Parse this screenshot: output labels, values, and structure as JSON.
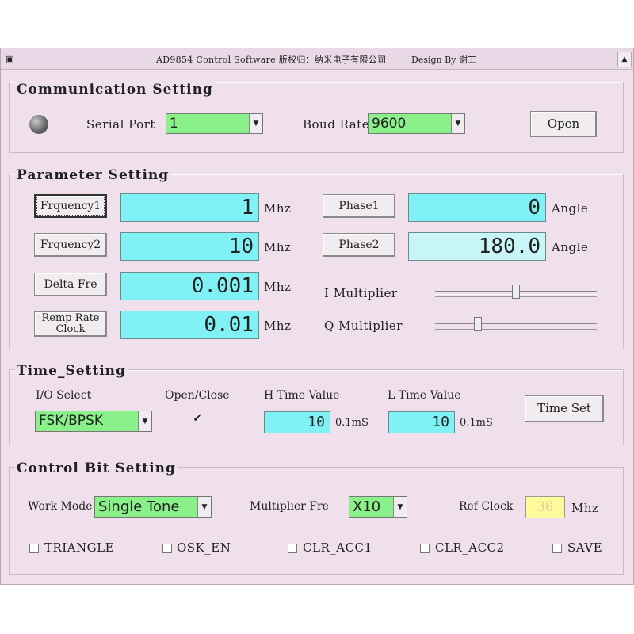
{
  "window": {
    "title": "AD9854 Control Software  版权归：纳米电子有限公司",
    "credit": "Design By 谢工",
    "app_icon": "window-icon",
    "scroll_icon": "chevron-up-icon"
  },
  "communication": {
    "group_title": "Communication Setting",
    "status_led": "led-icon",
    "serial_port_label": "Serial Port",
    "serial_port_value": "1",
    "baud_rate_label": "Boud Rate",
    "baud_rate_value": "9600",
    "open_button": "Open"
  },
  "parameter": {
    "group_title": "Parameter Setting",
    "freq1_button": "Frquency1",
    "freq1_value": "1",
    "freq1_unit": "Mhz",
    "freq2_button": "Frquency2",
    "freq2_value": "10",
    "freq2_unit": "Mhz",
    "delta_button": "Delta Fre",
    "delta_value": "0.001",
    "delta_unit": "Mhz",
    "ramp_button_line1": "Remp Rate",
    "ramp_button_line2": "Clock",
    "ramp_value": "0.01",
    "ramp_unit": "Mhz",
    "phase1_button": "Phase1",
    "phase1_value": "0",
    "phase1_unit": "Angle",
    "phase2_button": "Phase2",
    "phase2_value": "180.0",
    "phase2_unit": "Angle",
    "i_multiplier_label": "I Multiplier",
    "i_multiplier_level": 0.5,
    "q_multiplier_label": "Q Multiplier",
    "q_multiplier_level": 0.25
  },
  "time": {
    "group_title": "Time_Setting",
    "io_select_label": "I/O Select",
    "io_select_value": "FSK/BPSK",
    "open_close_label": "Open/Close",
    "open_close_checked": true,
    "h_time_label": "H Time Value",
    "h_time_value": "10",
    "h_time_unit": "0.1mS",
    "l_time_label": "L Time Value",
    "l_time_value": "10",
    "l_time_unit": "0.1mS",
    "time_set_button": "Time Set"
  },
  "control": {
    "group_title": "Control Bit Setting",
    "work_mode_label": "Work Mode",
    "work_mode_value": "Single Tone",
    "multiplier_label": "Multiplier Fre",
    "multiplier_value": "X10",
    "ref_clock_label": "Ref Clock",
    "ref_clock_value": "30",
    "ref_clock_unit": "Mhz",
    "triangle_label": "TRIANGLE",
    "osk_label": "OSK_EN",
    "clr_acc1_label": "CLR_ACC1",
    "clr_acc2_label": "CLR_ACC2",
    "save_label": "SAVE"
  },
  "colors": {
    "window_bg": "#efe0ec",
    "field_cyan": "#80f2f6",
    "combo_green": "#8af089",
    "ref_yellow": "#fffb9c"
  }
}
